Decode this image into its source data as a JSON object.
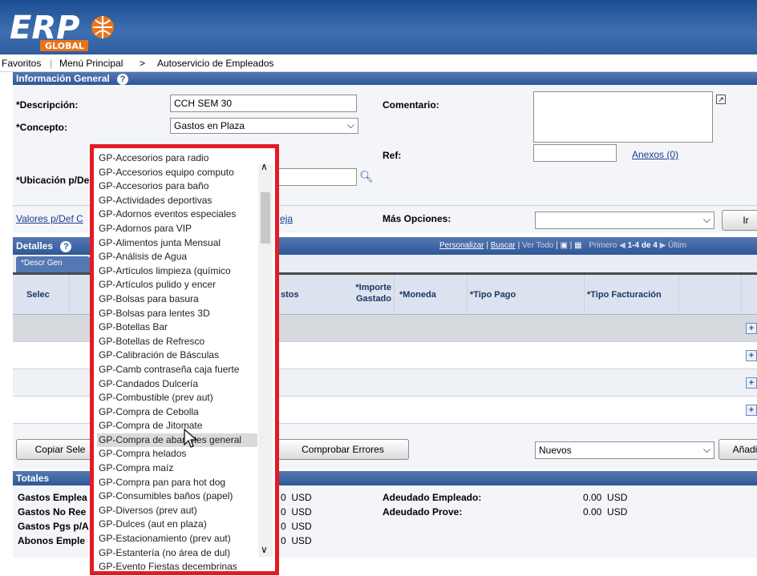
{
  "header": {
    "logo_text": "ERP",
    "logo_sub": "GLOBAL"
  },
  "nav": {
    "favoritos": "Favoritos",
    "menu_principal": "Menú Principal",
    "sep": ">",
    "autoservicio": "Autoservicio de Empleados"
  },
  "info_general": {
    "title": "Información General",
    "descripcion_label": "*Descripción:",
    "descripcion_value": "CCH SEM 30",
    "concepto_label": "*Concepto:",
    "concepto_value": "Gastos en Plaza",
    "comentario_label": "Comentario:",
    "ref_label": "Ref:",
    "anexos_link": "Anexos (0)",
    "ubicacion_label": "*Ubicación p/De",
    "valores_link": "Valores p/Def C",
    "valores_link_tail": "eja",
    "mas_opciones_label": "Más Opciones:",
    "mas_opciones_value": "",
    "ir_button": "Ir"
  },
  "detalles": {
    "title": "Detalles",
    "personalizar": "Personalizar",
    "buscar": "Buscar",
    "ver_todo": "Ver Todo",
    "primero": "Primero",
    "range": "1-4 de 4",
    "ultimo": "Últim",
    "tab_label": "*Descr Gen",
    "columns": {
      "selec": "Selec",
      "gastos": "stos",
      "importe": "*Importe Gastado",
      "moneda": "*Moneda",
      "tipo_pago": "*Tipo Pago",
      "tipo_facturacion": "*Tipo Facturación"
    },
    "plus": "+"
  },
  "actions": {
    "copiar": "Copiar Sele",
    "comprobar": "Comprobar Errores",
    "nuevos": "Nuevos",
    "anadir": "Añadir"
  },
  "totales": {
    "title": "Totales",
    "rows_left": [
      {
        "label": "Gastos Emplea",
        "value": "0  USD"
      },
      {
        "label": "Gastos No Ree",
        "value": "0  USD"
      },
      {
        "label": "Gastos Pgs p/A",
        "value": "0  USD"
      },
      {
        "label": "Abonos Emple",
        "value": "0  USD"
      }
    ],
    "adeudado_empleado_label": "Adeudado Empleado:",
    "adeudado_empleado_value": "0.00  USD",
    "adeudado_prove_label": "Adeudado Prove:",
    "adeudado_prove_value": "0.00  USD"
  },
  "dropdown": {
    "options": [
      "GP-Accesorios  para radio",
      "GP-Accesorios equipo computo",
      "GP-Accesorios para baño",
      "GP-Actividades deportivas",
      "GP-Adornos eventos especiales",
      "GP-Adornos para VIP",
      "GP-Alimentos junta Mensual",
      "GP-Análisis de Agua",
      "GP-Artículos limpieza (químico",
      "GP-Artículos pulido y encer",
      "GP-Bolsas para basura",
      "GP-Bolsas para lentes 3D",
      "GP-Botellas Bar",
      "GP-Botellas de Refresco",
      "GP-Calibración de Básculas",
      "GP-Camb contraseña caja fuerte",
      "GP-Candados Dulcería",
      "GP-Combustible (prev aut)",
      "GP-Compra de Cebolla",
      "GP-Compra de Jitomate",
      "GP-Compra de abarrotes general",
      "GP-Compra helados",
      "GP-Compra maíz",
      "GP-Compra pan para hot dog",
      "GP-Consumibles baños (papel)",
      "GP-Diversos (prev aut)",
      "GP-Dulces (aut en plaza)",
      "GP-Estacionamiento (prev aut)",
      "GP-Estantería (no área de dul)",
      "GP-Evento  Fiestas decembrinas"
    ],
    "highlighted_index": 20,
    "border_color": "#e31b23"
  }
}
